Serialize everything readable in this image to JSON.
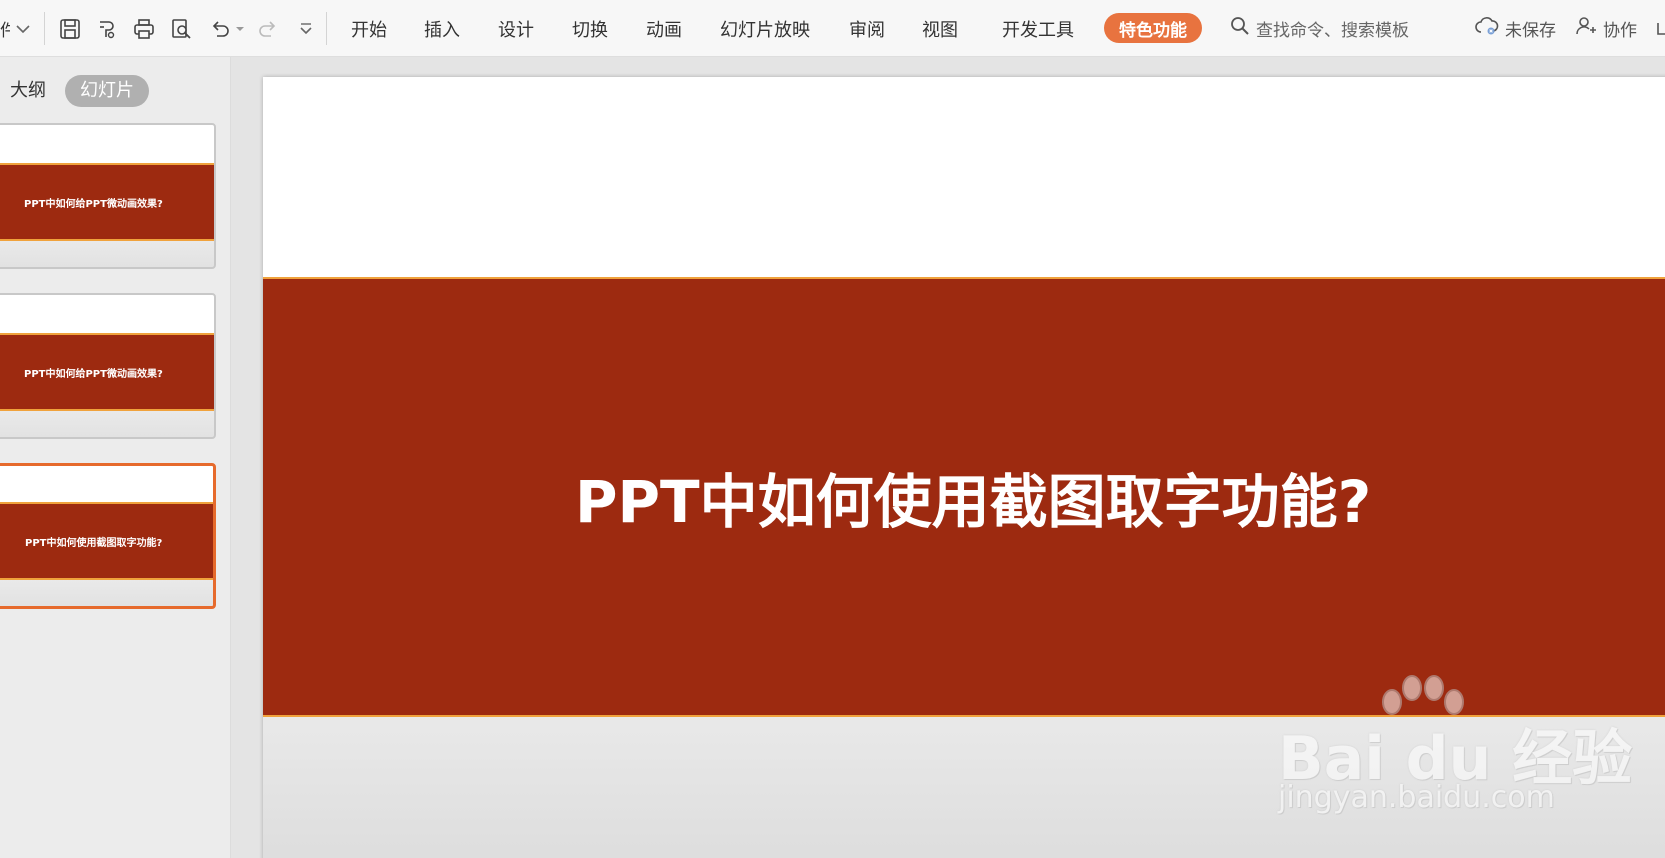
{
  "toolbar": {
    "file_stub": "件",
    "tabs": [
      {
        "label": "开始"
      },
      {
        "label": "插入"
      },
      {
        "label": "设计"
      },
      {
        "label": "切换"
      },
      {
        "label": "动画"
      },
      {
        "label": "幻灯片放映"
      },
      {
        "label": "审阅"
      },
      {
        "label": "视图"
      },
      {
        "label": "开发工具"
      }
    ],
    "special_tab": "特色功能",
    "search_placeholder": "查找命令、搜索模板",
    "unsaved_label": "未保存",
    "collab_label": "协作"
  },
  "left_panel": {
    "outline_label": "大纲",
    "slides_label": "幻灯片",
    "thumbnails": [
      {
        "title": "PPT中如何给PPT微动画效果?"
      },
      {
        "title": "PPT中如何给PPT微动画效果?"
      },
      {
        "title": "PPT中如何使用截图取字功能?"
      }
    ]
  },
  "slide": {
    "title": "PPT中如何使用截图取字功能?"
  },
  "watermark": {
    "brand": "Bai du 经验",
    "url": "jingyan.baidu.com"
  },
  "colors": {
    "accent": "#e8733f",
    "slide_band": "#9d2a10",
    "band_border": "#f0a23c"
  }
}
